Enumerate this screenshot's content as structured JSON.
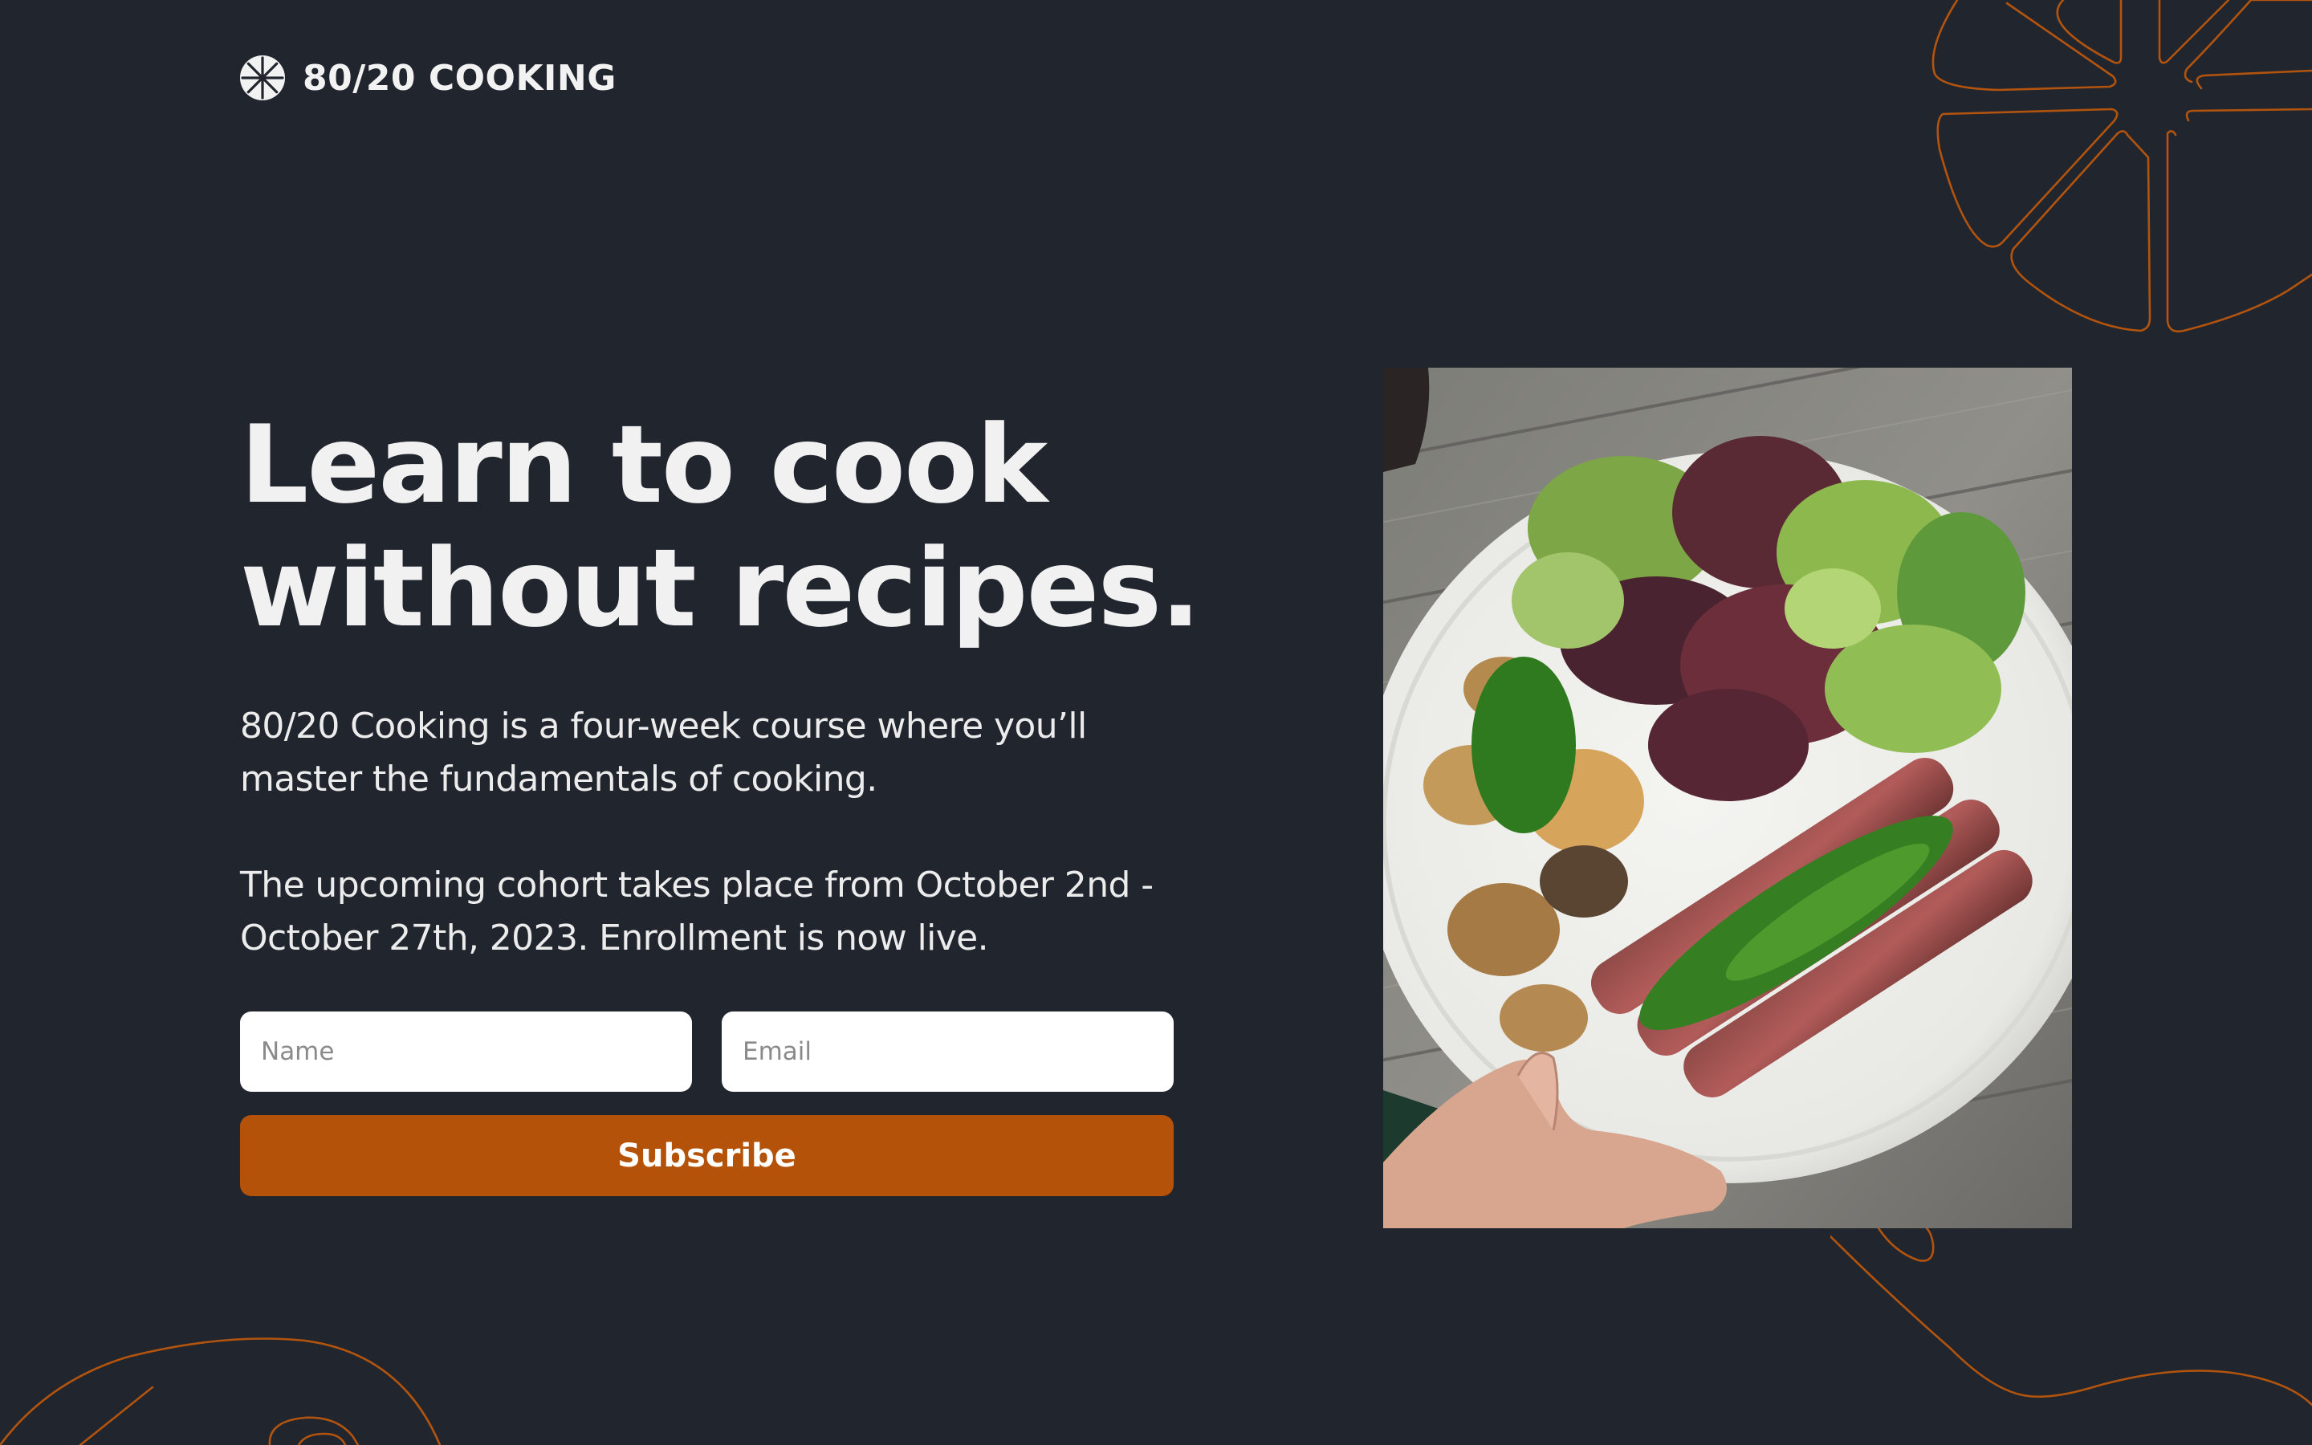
{
  "brand": {
    "name": "80/20 COOKING",
    "icon": "citrus-slice-icon"
  },
  "hero": {
    "title_line1": "Learn to cook",
    "title_line2": "without recipes.",
    "paragraph1_line1": "80/20 Cooking is a four-week course where you’ll",
    "paragraph1_line2": "master the fundamentals of cooking.",
    "paragraph2_line1": "The upcoming cohort takes place from October 2nd -",
    "paragraph2_line2": "October 27th, 2023. Enrollment is now live."
  },
  "form": {
    "name_placeholder": "Name",
    "email_placeholder": "Email",
    "subscribe_label": "Subscribe"
  },
  "colors": {
    "background": "#21252e",
    "accent": "#b5520a",
    "text": "#f1f1f1"
  }
}
